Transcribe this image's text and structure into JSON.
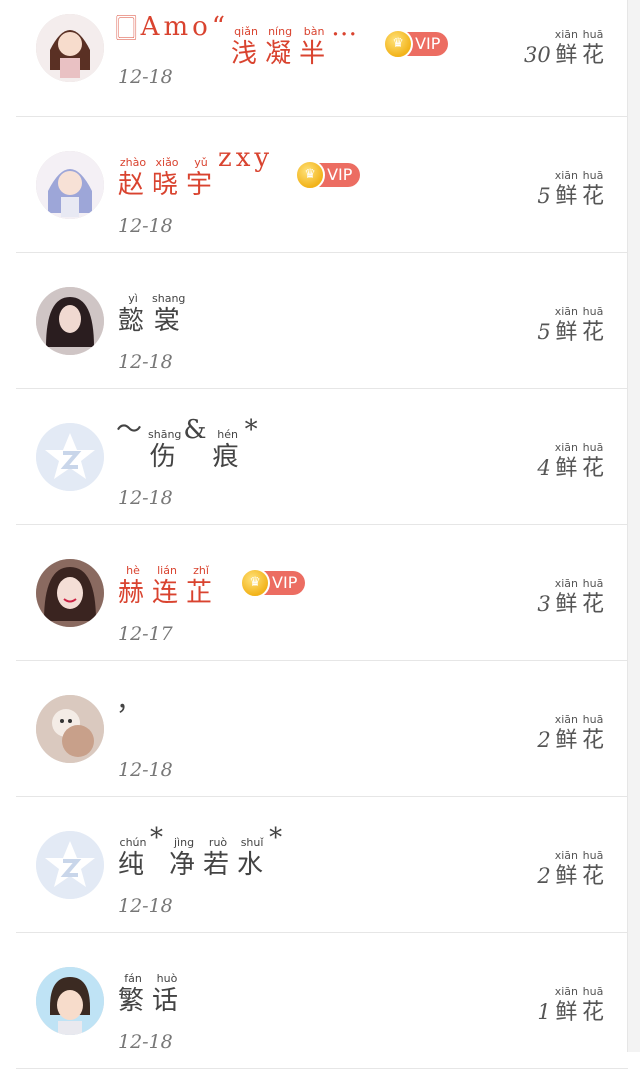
{
  "flower_word": [
    {
      "py": "xiān",
      "ch": "鲜"
    },
    {
      "py": "huā",
      "ch": "花"
    }
  ],
  "rows": [
    {
      "name_segments": [
        {
          "plain": "🀆Amo“"
        },
        {
          "py": "qiǎn",
          "ch": "浅"
        },
        {
          "py": "níng",
          "ch": "凝"
        },
        {
          "py": "bàn",
          "ch": "半"
        },
        {
          "plain": "…"
        }
      ],
      "vip": true,
      "vip_label": "VIP",
      "date": "12-18",
      "count": "30",
      "avatar": "anime-girl-dark"
    },
    {
      "name_segments": [
        {
          "py": "zhào",
          "ch": "赵"
        },
        {
          "py": "xiǎo",
          "ch": "晓"
        },
        {
          "py": "yǔ",
          "ch": "宇"
        },
        {
          "plain": "zxy"
        }
      ],
      "vip": true,
      "vip_label": "VIP",
      "date": "12-18",
      "count": "5",
      "avatar": "anime-girl-blue"
    },
    {
      "name_segments": [
        {
          "py": "yì",
          "ch": "懿"
        },
        {
          "py": "shang",
          "ch": "裳"
        }
      ],
      "vip": false,
      "date": "12-18",
      "count": "5",
      "avatar": "photo-woman-dark-hair"
    },
    {
      "name_segments": [
        {
          "plain": "～"
        },
        {
          "py": "shāng",
          "ch": "伤"
        },
        {
          "plain": "&"
        },
        {
          "py": "hén",
          "ch": "痕"
        },
        {
          "plain": "*"
        }
      ],
      "vip": false,
      "date": "12-18",
      "count": "4",
      "avatar": "default-star"
    },
    {
      "name_segments": [
        {
          "py": "hè",
          "ch": "赫"
        },
        {
          "py": "lián",
          "ch": "连"
        },
        {
          "py": "zhǐ",
          "ch": "芷"
        }
      ],
      "vip": true,
      "vip_label": "VIP",
      "date": "12-17",
      "count": "3",
      "avatar": "photo-woman-smile"
    },
    {
      "name_segments": [
        {
          "plain": "，"
        }
      ],
      "vip": false,
      "date": "12-18",
      "count": "2",
      "avatar": "photo-plush-toy"
    },
    {
      "name_segments": [
        {
          "py": "chún",
          "ch": "纯"
        },
        {
          "plain": "*"
        },
        {
          "py": "jìng",
          "ch": "净"
        },
        {
          "py": "ruò",
          "ch": "若"
        },
        {
          "py": "shuǐ",
          "ch": "水"
        },
        {
          "plain": "*"
        }
      ],
      "vip": false,
      "date": "12-18",
      "count": "2",
      "avatar": "default-star"
    },
    {
      "name_segments": [
        {
          "py": "fán",
          "ch": "繁"
        },
        {
          "py": "huò",
          "ch": "话"
        }
      ],
      "vip": false,
      "date": "12-18",
      "count": "1",
      "avatar": "cartoon-girl-short-hair"
    }
  ],
  "colors": {
    "vip_name": "#d9432f",
    "normal_name": "#444444",
    "vip_badge": "#ec6d62",
    "crown": "#f2b31a",
    "divider": "#e6e6e6"
  }
}
